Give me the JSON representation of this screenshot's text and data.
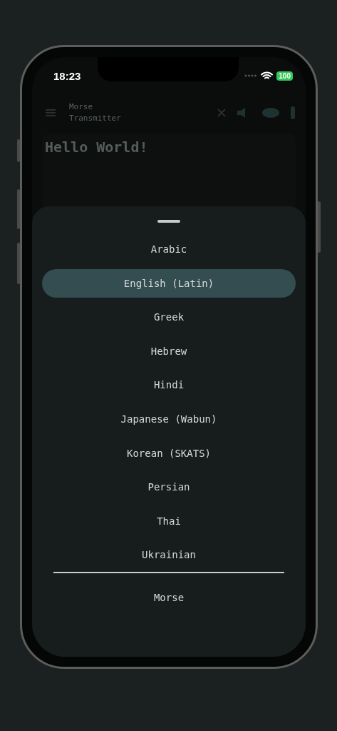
{
  "status_bar": {
    "time": "18:23",
    "battery": "100"
  },
  "app_header": {
    "title_lines": [
      "Morse",
      "Transmitter"
    ]
  },
  "editor": {
    "text": "Hello World!"
  },
  "sheet": {
    "items": [
      {
        "label": "Arabic",
        "selected": false
      },
      {
        "label": "English (Latin)",
        "selected": true
      },
      {
        "label": "Greek",
        "selected": false
      },
      {
        "label": "Hebrew",
        "selected": false
      },
      {
        "label": "Hindi",
        "selected": false
      },
      {
        "label": "Japanese (Wabun)",
        "selected": false
      },
      {
        "label": "Korean (SKATS)",
        "selected": false
      },
      {
        "label": "Persian",
        "selected": false
      },
      {
        "label": "Thai",
        "selected": false
      },
      {
        "label": "Ukrainian",
        "selected": false
      }
    ],
    "footer_items": [
      {
        "label": "Morse",
        "selected": false
      }
    ]
  }
}
